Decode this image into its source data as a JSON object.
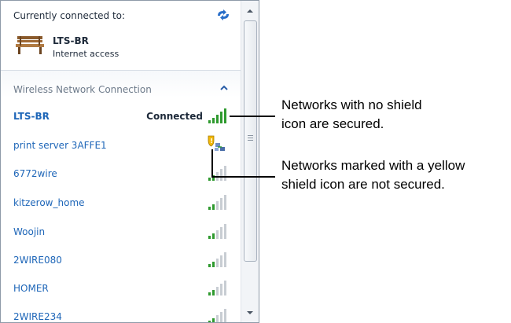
{
  "header": {
    "connected_label": "Currently connected to:",
    "current_network": "LTS-BR",
    "current_status": "Internet access"
  },
  "section": {
    "title": "Wireless Network Connection"
  },
  "networks": [
    {
      "name": "LTS-BR",
      "status": "Connected",
      "secured": true,
      "active": true
    },
    {
      "name": "print server 3AFFE1",
      "secured": false
    },
    {
      "name": "6772wire",
      "secured": true
    },
    {
      "name": "kitzerow_home",
      "secured": true
    },
    {
      "name": "Woojin",
      "secured": true
    },
    {
      "name": "2WIRE080",
      "secured": true
    },
    {
      "name": "HOMER",
      "secured": true
    },
    {
      "name": "2WIRE234",
      "secured": true
    }
  ],
  "callouts": {
    "secured": [
      "Networks with no shield",
      "icon are secured."
    ],
    "not_secured": [
      "Networks marked with a yellow",
      "shield icon are not secured."
    ]
  },
  "colors": {
    "link": "#1e66b8",
    "signal": "#2f9a2f",
    "shield": "#f2b705"
  }
}
